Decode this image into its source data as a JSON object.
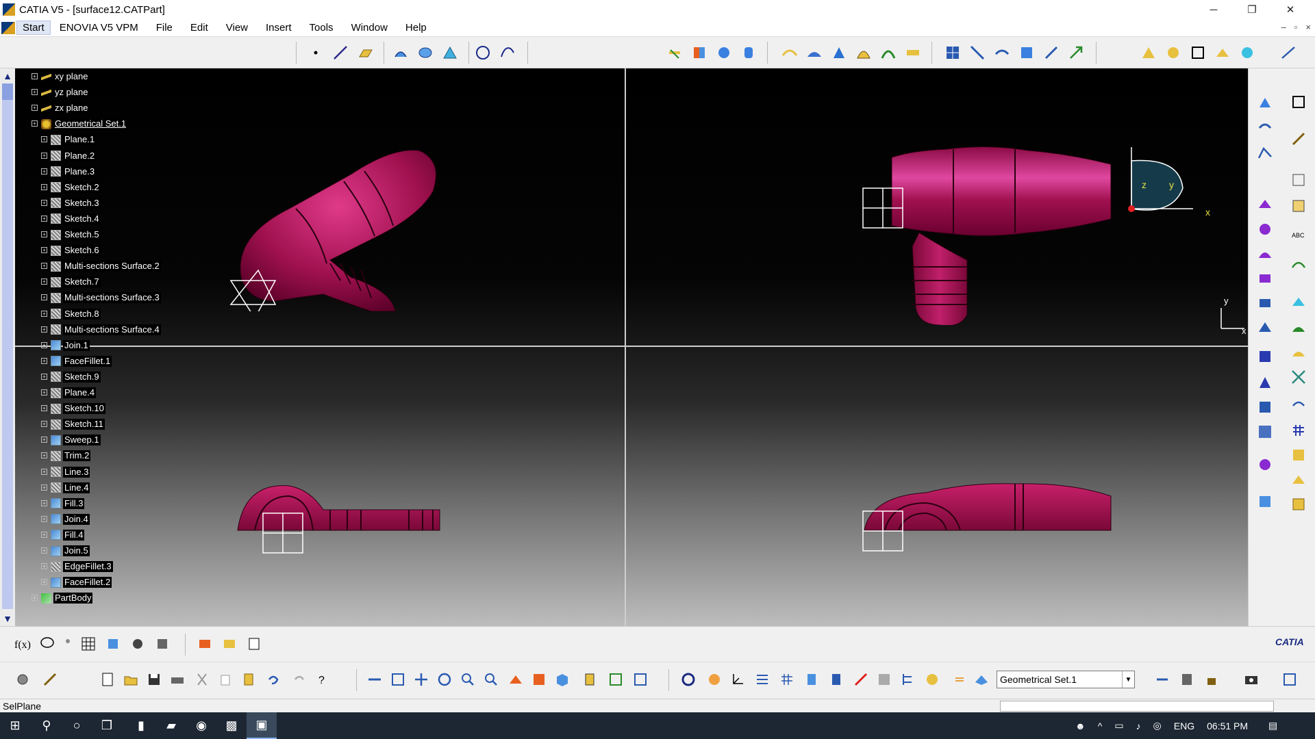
{
  "window": {
    "title": "CATIA V5 - [surface12.CATPart]",
    "minimize": "─",
    "restore": "❐",
    "close": "✕"
  },
  "menu": {
    "start": "Start",
    "items": [
      "ENOVIA V5 VPM",
      "File",
      "Edit",
      "View",
      "Insert",
      "Tools",
      "Window",
      "Help"
    ]
  },
  "tree": {
    "items": [
      {
        "label": "xy plane",
        "icon": "plane-icon",
        "indent": 0
      },
      {
        "label": "yz plane",
        "icon": "plane-icon",
        "indent": 0
      },
      {
        "label": "zx plane",
        "icon": "plane-icon",
        "indent": 0
      },
      {
        "label": "Geometrical Set.1",
        "icon": "geometrical-set-icon",
        "indent": 0
      },
      {
        "label": "Plane.1",
        "icon": "feature-icon",
        "indent": 1
      },
      {
        "label": "Plane.2",
        "icon": "feature-icon",
        "indent": 1
      },
      {
        "label": "Plane.3",
        "icon": "feature-icon",
        "indent": 1
      },
      {
        "label": "Sketch.2",
        "icon": "feature-icon",
        "indent": 1
      },
      {
        "label": "Sketch.3",
        "icon": "feature-icon",
        "indent": 1
      },
      {
        "label": "Sketch.4",
        "icon": "feature-icon",
        "indent": 1
      },
      {
        "label": "Sketch.5",
        "icon": "feature-icon",
        "indent": 1
      },
      {
        "label": "Sketch.6",
        "icon": "feature-icon",
        "indent": 1
      },
      {
        "label": "Multi-sections Surface.2",
        "icon": "feature-icon",
        "indent": 1
      },
      {
        "label": "Sketch.7",
        "icon": "feature-icon",
        "indent": 1
      },
      {
        "label": "Multi-sections Surface.3",
        "icon": "feature-icon",
        "indent": 1
      },
      {
        "label": "Sketch.8",
        "icon": "feature-icon",
        "indent": 1
      },
      {
        "label": "Multi-sections Surface.4",
        "icon": "feature-icon",
        "indent": 1
      },
      {
        "label": "Join.1",
        "icon": "join-icon",
        "indent": 1
      },
      {
        "label": "FaceFillet.1",
        "icon": "join-icon",
        "indent": 1
      },
      {
        "label": "Sketch.9",
        "icon": "feature-icon",
        "indent": 1
      },
      {
        "label": "Plane.4",
        "icon": "feature-icon",
        "indent": 1
      },
      {
        "label": "Sketch.10",
        "icon": "feature-icon",
        "indent": 1
      },
      {
        "label": "Sketch.11",
        "icon": "feature-icon",
        "indent": 1
      },
      {
        "label": "Sweep.1",
        "icon": "join-icon",
        "indent": 1
      },
      {
        "label": "Trim.2",
        "icon": "feature-icon",
        "indent": 1
      },
      {
        "label": "Line.3",
        "icon": "feature-icon",
        "indent": 1
      },
      {
        "label": "Line.4",
        "icon": "feature-icon",
        "indent": 1
      },
      {
        "label": "Fill.3",
        "icon": "join-icon",
        "indent": 1
      },
      {
        "label": "Join.4",
        "icon": "join-icon",
        "indent": 1
      },
      {
        "label": "Fill.4",
        "icon": "join-icon",
        "indent": 1
      },
      {
        "label": "Join.5",
        "icon": "join-icon",
        "indent": 1
      },
      {
        "label": "EdgeFillet.3",
        "icon": "feature-icon",
        "indent": 1
      },
      {
        "label": "FaceFillet.2",
        "icon": "join-icon",
        "indent": 1
      },
      {
        "label": "PartBody",
        "icon": "partbody-icon",
        "indent": 0
      }
    ]
  },
  "compass": {
    "y": "y",
    "x": "x",
    "z": "z"
  },
  "axis_small": {
    "y": "y",
    "x": "x"
  },
  "current_set": "Geometrical Set.1",
  "status": "SelPlane",
  "taskbar": {
    "lang": "ENG",
    "time": "06:51 PM"
  },
  "brand": "CATIA",
  "colors": {
    "part": "#a0114f",
    "tree_label_bg": "#000000",
    "scrollbar": "#bfc8ee"
  }
}
